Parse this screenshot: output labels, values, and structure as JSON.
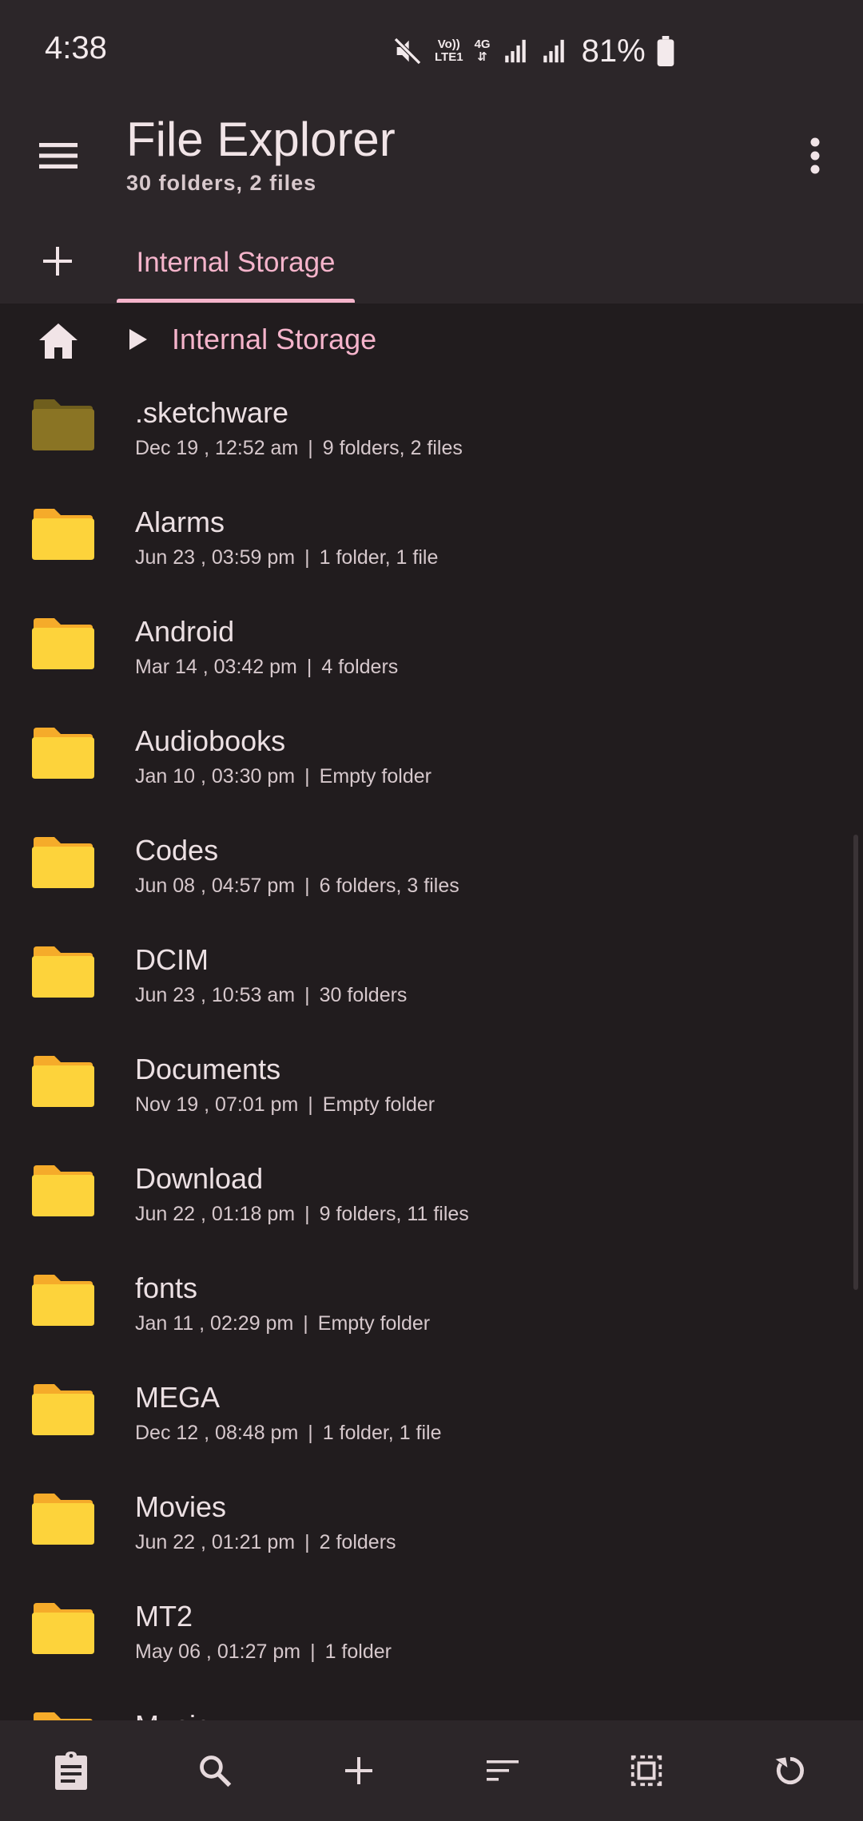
{
  "status_bar": {
    "time": "4:38",
    "battery": "81%",
    "network": "4G",
    "volte_line1": "Vo))",
    "volte_line2": "LTE1",
    "icons": [
      "mute-icon",
      "volte-icon",
      "4g-icon",
      "signal-icon",
      "signal-icon",
      "battery-icon"
    ]
  },
  "app_bar": {
    "title": "File Explorer",
    "subtitle": "30 folders, 2 files",
    "menu_icon": "hamburger-icon",
    "more_icon": "more-vert-icon"
  },
  "tabs": [
    {
      "label": "Internal Storage",
      "active": true
    }
  ],
  "breadcrumb": {
    "home_icon": "home-icon",
    "items": [
      "Internal Storage"
    ]
  },
  "files": [
    {
      "name": ".sketchware",
      "date": "Dec 19 , 12:52 am",
      "info": "9 folders, 2 files",
      "hidden": true
    },
    {
      "name": "Alarms",
      "date": "Jun 23 , 03:59 pm",
      "info": "1 folder, 1 file",
      "hidden": false
    },
    {
      "name": "Android",
      "date": "Mar 14 , 03:42 pm",
      "info": "4 folders",
      "hidden": false
    },
    {
      "name": "Audiobooks",
      "date": "Jan 10 , 03:30 pm",
      "info": "Empty folder",
      "hidden": false
    },
    {
      "name": "Codes",
      "date": "Jun 08 , 04:57 pm",
      "info": "6 folders, 3 files",
      "hidden": false
    },
    {
      "name": "DCIM",
      "date": "Jun 23 , 10:53 am",
      "info": "30 folders",
      "hidden": false
    },
    {
      "name": "Documents",
      "date": "Nov 19 , 07:01 pm",
      "info": "Empty folder",
      "hidden": false
    },
    {
      "name": "Download",
      "date": "Jun 22 , 01:18 pm",
      "info": "9 folders, 11 files",
      "hidden": false
    },
    {
      "name": "fonts",
      "date": "Jan 11 , 02:29 pm",
      "info": "Empty folder",
      "hidden": false
    },
    {
      "name": "MEGA",
      "date": "Dec 12 , 08:48 pm",
      "info": "1 folder, 1 file",
      "hidden": false
    },
    {
      "name": "Movies",
      "date": "Jun 22 , 01:21 pm",
      "info": "2 folders",
      "hidden": false
    },
    {
      "name": "MT2",
      "date": "May 06 , 01:27 pm",
      "info": "1 folder",
      "hidden": false
    },
    {
      "name": "Music",
      "date": "",
      "info": "",
      "hidden": false
    }
  ],
  "meta_separator": "|",
  "bottom_bar": [
    {
      "name": "clipboard-icon"
    },
    {
      "name": "search-icon"
    },
    {
      "name": "add-icon"
    },
    {
      "name": "sort-icon"
    },
    {
      "name": "select-all-icon"
    },
    {
      "name": "refresh-icon"
    }
  ],
  "colors": {
    "background": "#211c1e",
    "bar": "#2c2629",
    "accent": "#f5b4cb",
    "folder": "#fdd33b",
    "folder_back": "#f5ab2a",
    "hidden_folder": "#8a7424"
  }
}
